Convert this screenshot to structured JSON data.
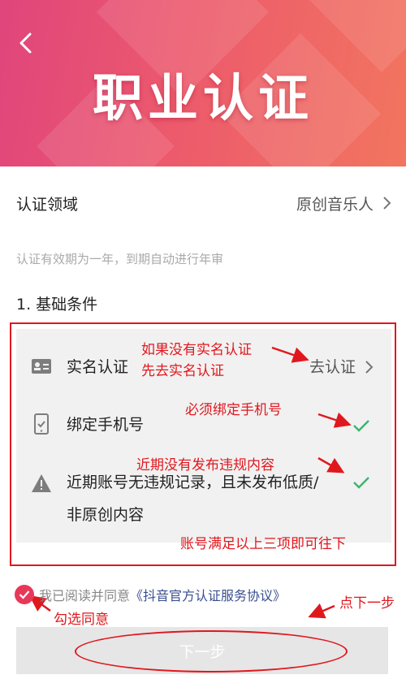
{
  "header": {
    "title": "职业认证",
    "gradient_start": "#e0457c",
    "gradient_end": "#f2755f"
  },
  "domain": {
    "label": "认证领域",
    "value": "原创音乐人"
  },
  "validity_note": "认证有效期为一年，到期自动进行年审",
  "section_title": "1. 基础条件",
  "conditions": [
    {
      "icon": "id-card-icon",
      "label": "实名认证",
      "action": "去认证",
      "status": "pending"
    },
    {
      "icon": "phone-icon",
      "label": "绑定手机号",
      "status": "met"
    },
    {
      "icon": "warning-icon",
      "label_line1": "近期账号无违规记录，且未发布低质/",
      "label_line2": "非原创内容",
      "status": "met"
    }
  ],
  "annotations": {
    "realname_line1": "如果没有实名认证",
    "realname_line2": "先去实名认证",
    "phone": "必须绑定手机号",
    "violation": "近期没有发布违规内容",
    "summary": "账号满足以上三项即可往下",
    "agree": "勾选同意",
    "next": "点下一步",
    "color": "#e0181e"
  },
  "agreement": {
    "text": "我已阅读并同意",
    "link": "《抖音官方认证服务协议》",
    "checked": true
  },
  "next_button": {
    "label": "下一步"
  }
}
